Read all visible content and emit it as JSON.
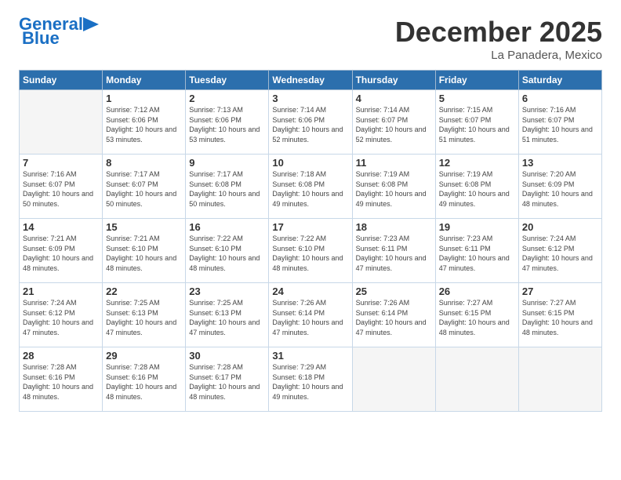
{
  "header": {
    "logo_line1": "General",
    "logo_line2": "Blue",
    "month": "December 2025",
    "location": "La Panadera, Mexico"
  },
  "weekdays": [
    "Sunday",
    "Monday",
    "Tuesday",
    "Wednesday",
    "Thursday",
    "Friday",
    "Saturday"
  ],
  "weeks": [
    [
      {
        "day": "",
        "empty": true
      },
      {
        "day": "1",
        "sunrise": "7:12 AM",
        "sunset": "6:06 PM",
        "daylight": "10 hours and 53 minutes."
      },
      {
        "day": "2",
        "sunrise": "7:13 AM",
        "sunset": "6:06 PM",
        "daylight": "10 hours and 53 minutes."
      },
      {
        "day": "3",
        "sunrise": "7:14 AM",
        "sunset": "6:06 PM",
        "daylight": "10 hours and 52 minutes."
      },
      {
        "day": "4",
        "sunrise": "7:14 AM",
        "sunset": "6:07 PM",
        "daylight": "10 hours and 52 minutes."
      },
      {
        "day": "5",
        "sunrise": "7:15 AM",
        "sunset": "6:07 PM",
        "daylight": "10 hours and 51 minutes."
      },
      {
        "day": "6",
        "sunrise": "7:16 AM",
        "sunset": "6:07 PM",
        "daylight": "10 hours and 51 minutes."
      }
    ],
    [
      {
        "day": "7",
        "sunrise": "7:16 AM",
        "sunset": "6:07 PM",
        "daylight": "10 hours and 50 minutes."
      },
      {
        "day": "8",
        "sunrise": "7:17 AM",
        "sunset": "6:07 PM",
        "daylight": "10 hours and 50 minutes."
      },
      {
        "day": "9",
        "sunrise": "7:17 AM",
        "sunset": "6:08 PM",
        "daylight": "10 hours and 50 minutes."
      },
      {
        "day": "10",
        "sunrise": "7:18 AM",
        "sunset": "6:08 PM",
        "daylight": "10 hours and 49 minutes."
      },
      {
        "day": "11",
        "sunrise": "7:19 AM",
        "sunset": "6:08 PM",
        "daylight": "10 hours and 49 minutes."
      },
      {
        "day": "12",
        "sunrise": "7:19 AM",
        "sunset": "6:08 PM",
        "daylight": "10 hours and 49 minutes."
      },
      {
        "day": "13",
        "sunrise": "7:20 AM",
        "sunset": "6:09 PM",
        "daylight": "10 hours and 48 minutes."
      }
    ],
    [
      {
        "day": "14",
        "sunrise": "7:21 AM",
        "sunset": "6:09 PM",
        "daylight": "10 hours and 48 minutes."
      },
      {
        "day": "15",
        "sunrise": "7:21 AM",
        "sunset": "6:10 PM",
        "daylight": "10 hours and 48 minutes."
      },
      {
        "day": "16",
        "sunrise": "7:22 AM",
        "sunset": "6:10 PM",
        "daylight": "10 hours and 48 minutes."
      },
      {
        "day": "17",
        "sunrise": "7:22 AM",
        "sunset": "6:10 PM",
        "daylight": "10 hours and 48 minutes."
      },
      {
        "day": "18",
        "sunrise": "7:23 AM",
        "sunset": "6:11 PM",
        "daylight": "10 hours and 47 minutes."
      },
      {
        "day": "19",
        "sunrise": "7:23 AM",
        "sunset": "6:11 PM",
        "daylight": "10 hours and 47 minutes."
      },
      {
        "day": "20",
        "sunrise": "7:24 AM",
        "sunset": "6:12 PM",
        "daylight": "10 hours and 47 minutes."
      }
    ],
    [
      {
        "day": "21",
        "sunrise": "7:24 AM",
        "sunset": "6:12 PM",
        "daylight": "10 hours and 47 minutes."
      },
      {
        "day": "22",
        "sunrise": "7:25 AM",
        "sunset": "6:13 PM",
        "daylight": "10 hours and 47 minutes."
      },
      {
        "day": "23",
        "sunrise": "7:25 AM",
        "sunset": "6:13 PM",
        "daylight": "10 hours and 47 minutes."
      },
      {
        "day": "24",
        "sunrise": "7:26 AM",
        "sunset": "6:14 PM",
        "daylight": "10 hours and 47 minutes."
      },
      {
        "day": "25",
        "sunrise": "7:26 AM",
        "sunset": "6:14 PM",
        "daylight": "10 hours and 47 minutes."
      },
      {
        "day": "26",
        "sunrise": "7:27 AM",
        "sunset": "6:15 PM",
        "daylight": "10 hours and 48 minutes."
      },
      {
        "day": "27",
        "sunrise": "7:27 AM",
        "sunset": "6:15 PM",
        "daylight": "10 hours and 48 minutes."
      }
    ],
    [
      {
        "day": "28",
        "sunrise": "7:28 AM",
        "sunset": "6:16 PM",
        "daylight": "10 hours and 48 minutes."
      },
      {
        "day": "29",
        "sunrise": "7:28 AM",
        "sunset": "6:16 PM",
        "daylight": "10 hours and 48 minutes."
      },
      {
        "day": "30",
        "sunrise": "7:28 AM",
        "sunset": "6:17 PM",
        "daylight": "10 hours and 48 minutes."
      },
      {
        "day": "31",
        "sunrise": "7:29 AM",
        "sunset": "6:18 PM",
        "daylight": "10 hours and 49 minutes."
      },
      {
        "day": "",
        "empty": true
      },
      {
        "day": "",
        "empty": true
      },
      {
        "day": "",
        "empty": true
      }
    ]
  ]
}
